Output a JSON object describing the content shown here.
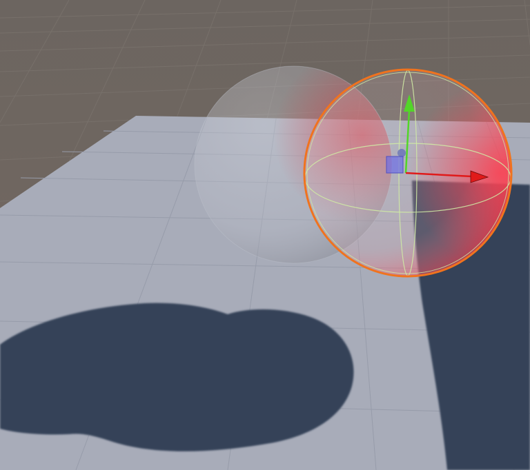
{
  "scene": {
    "view": "scene-view",
    "background_color": "#6e6661",
    "plane_color": "#a7abb8",
    "shadow_color": "#344259",
    "selection_outline_color": "#f0731e",
    "gizmo": {
      "x_axis_color": "#e01a1a",
      "y_axis_color": "#52d628",
      "center_handle_color": "#6e6ee6"
    },
    "objects": [
      {
        "name": "sphere",
        "selected": false,
        "material": "transparent-grey"
      },
      {
        "name": "sphere-selected",
        "selected": true,
        "material": "transparent-red"
      }
    ]
  }
}
